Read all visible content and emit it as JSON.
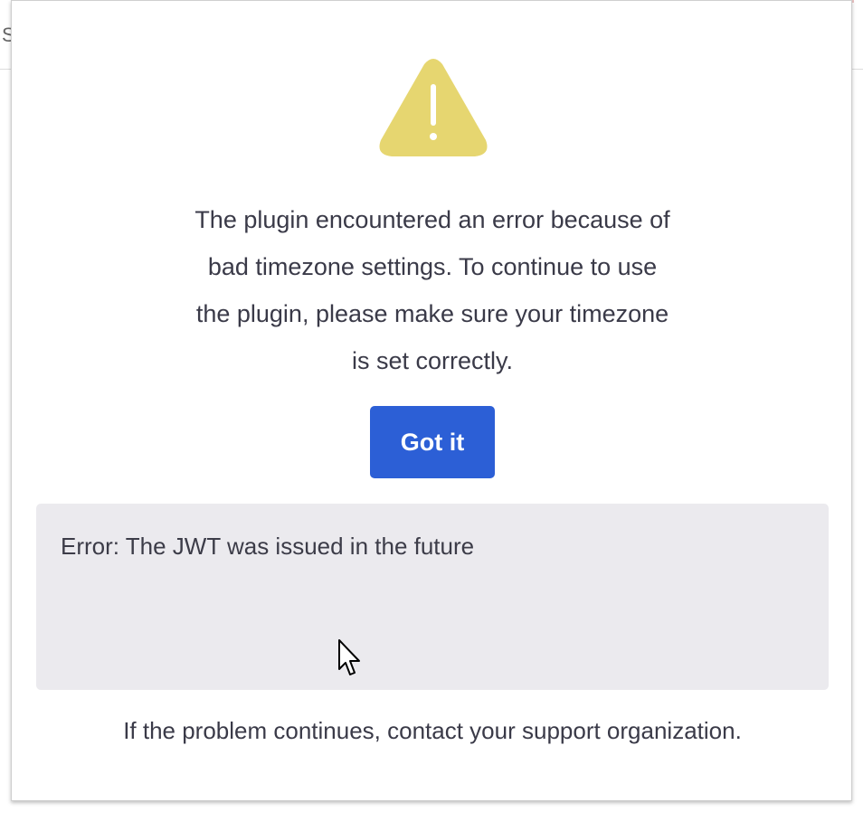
{
  "background": {
    "fragment_text": "S"
  },
  "dialog": {
    "icon": "warning-triangle-icon",
    "icon_color": "#e6d670",
    "message_lines": [
      "The plugin encountered an error because of",
      "bad timezone settings. To continue to use",
      "the plugin, please make sure your timezone",
      "is set correctly."
    ],
    "button_label": "Got it",
    "button_color": "#2c5fd6",
    "error_detail": "Error: The JWT was issued in the future",
    "footer": "If the problem continues, contact your support organization."
  },
  "pointer": {
    "icon": "mouse-cursor-icon"
  }
}
